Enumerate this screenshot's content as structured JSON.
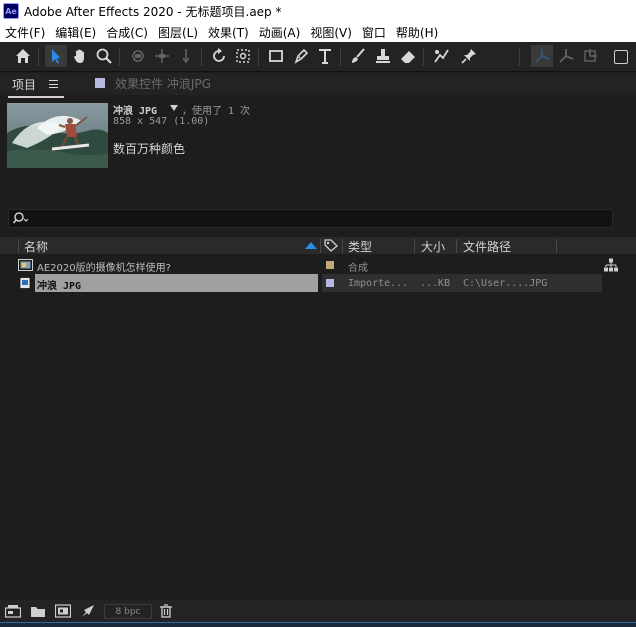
{
  "window": {
    "app_icon_text": "Ae",
    "title": "Adobe After Effects 2020 - 无标题项目.aep *"
  },
  "menu": {
    "items": [
      "文件(F)",
      "编辑(E)",
      "合成(C)",
      "图层(L)",
      "效果(T)",
      "动画(A)",
      "视图(V)",
      "窗口",
      "帮助(H)"
    ]
  },
  "toolbar": {
    "tools": [
      "home-icon",
      "selection-tool-icon",
      "hand-tool-icon",
      "zoom-tool-icon",
      "orbit-camera-icon",
      "pan-camera-icon",
      "dolly-camera-icon",
      "rotation-tool-icon",
      "anchor-point-tool-icon",
      "rectangle-tool-icon",
      "pen-tool-icon",
      "type-tool-icon",
      "brush-tool-icon",
      "clone-stamp-tool-icon",
      "eraser-tool-icon",
      "roto-brush-tool-icon",
      "puppet-pin-tool-icon",
      "local-axis-icon",
      "world-axis-icon",
      "view-axis-icon",
      "snapping-checkbox"
    ]
  },
  "panel": {
    "project_tab": "项目",
    "effects_tab": "效果控件 冲浪JPG"
  },
  "preview": {
    "name": "冲浪 JPG",
    "used": "，使用了 1 次",
    "dimensions": "858 x 547 (1.00)",
    "color": "数百万种颜色"
  },
  "search": {
    "placeholder": ""
  },
  "columns": {
    "name": "名称",
    "type": "类型",
    "size": "大小",
    "path": "文件路径"
  },
  "rows": [
    {
      "name": "AE2020版的摄像机怎样使用?",
      "type": "合成",
      "size": "",
      "path": "",
      "swatch": "#c2a878",
      "selected": false
    },
    {
      "name": "冲浪 JPG",
      "type": "Importe...",
      "size": "...KB",
      "path": "C:\\User....JPG",
      "swatch": "#b7b8e0",
      "selected": true
    }
  ],
  "bottombar": {
    "bpc": "8 bpc"
  },
  "colors": {
    "accent": "#2d8ceb",
    "panel_bg": "#1d1d1d",
    "selected_row": "#a0a0a0"
  }
}
